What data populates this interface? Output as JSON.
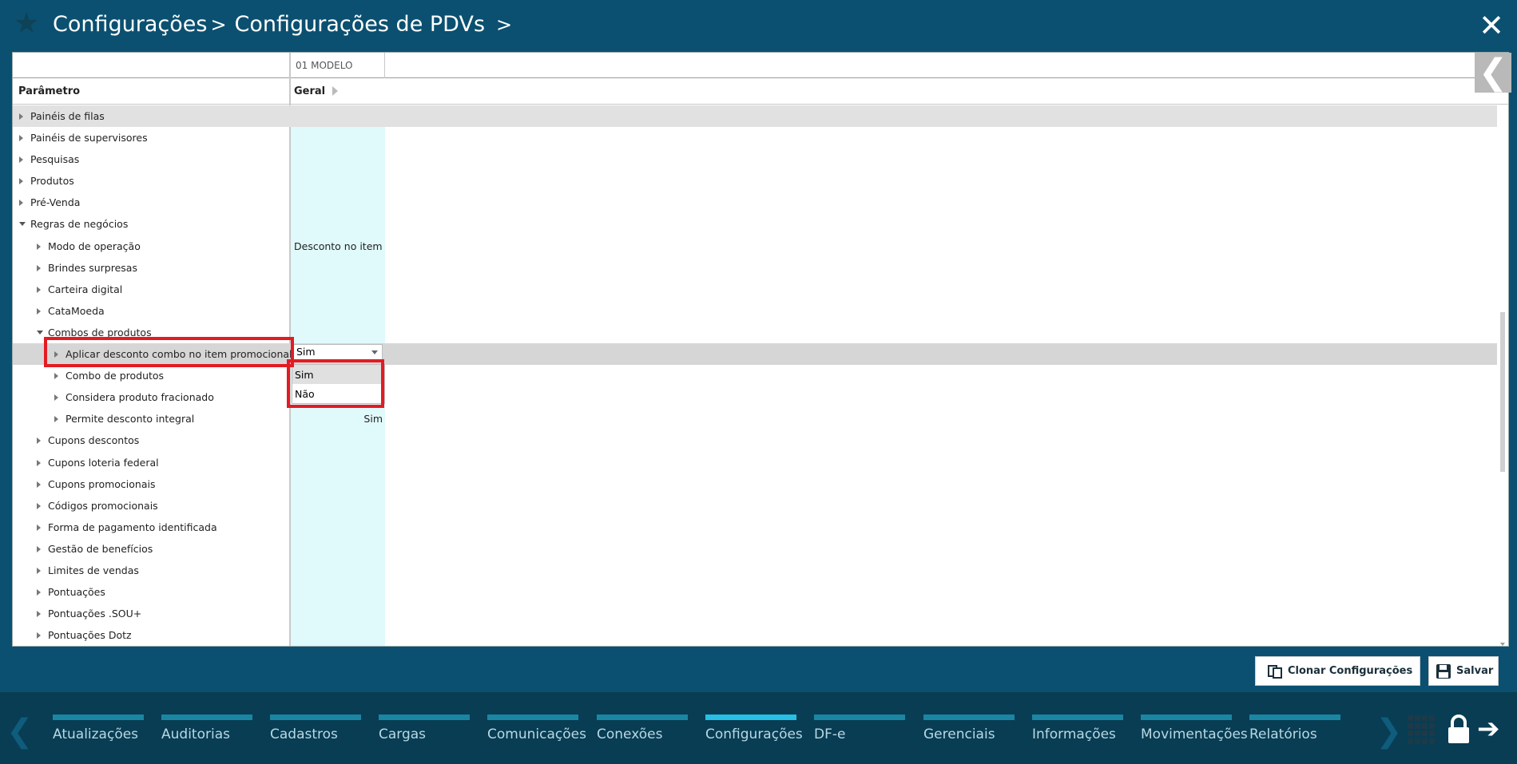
{
  "header": {
    "breadcrumb_1": "Configurações",
    "breadcrumb_sep_1": ">",
    "breadcrumb_2": "Configurações de PDVs",
    "breadcrumb_sep_2": ">",
    "close_icon": "✕"
  },
  "grid": {
    "model_header": "01 MODELO",
    "param_header": "Parâmetro",
    "group_header": "Geral",
    "rows": [
      {
        "label": "Painéis de filas",
        "value": ""
      },
      {
        "label": "Painéis de supervisores",
        "value": ""
      },
      {
        "label": "Pesquisas",
        "value": ""
      },
      {
        "label": "Produtos",
        "value": ""
      },
      {
        "label": "Pré-Venda",
        "value": ""
      },
      {
        "label": "Regras de negócios",
        "value": ""
      },
      {
        "label": "Modo de operação",
        "value": "Desconto no item"
      },
      {
        "label": "Brindes surpresas",
        "value": ""
      },
      {
        "label": "Carteira digital",
        "value": ""
      },
      {
        "label": "CataMoeda",
        "value": ""
      },
      {
        "label": "Combos de produtos",
        "value": ""
      },
      {
        "label": "Aplicar desconto combo no item promocional",
        "value": ""
      },
      {
        "label": "Combo de produtos",
        "value": ""
      },
      {
        "label": "Considera produto fracionado",
        "value": ""
      },
      {
        "label": "Permite desconto integral",
        "value": "Sim"
      },
      {
        "label": "Cupons descontos",
        "value": ""
      },
      {
        "label": "Cupons loteria federal",
        "value": ""
      },
      {
        "label": "Cupons promocionais",
        "value": ""
      },
      {
        "label": "Códigos promocionais",
        "value": ""
      },
      {
        "label": "Forma de pagamento identificada",
        "value": ""
      },
      {
        "label": "Gestão de benefícios",
        "value": ""
      },
      {
        "label": "Limites de vendas",
        "value": ""
      },
      {
        "label": "Pontuações",
        "value": ""
      },
      {
        "label": "Pontuações .SOU+",
        "value": ""
      },
      {
        "label": "Pontuações Dotz",
        "value": ""
      }
    ],
    "select_value": "Sim",
    "dropdown_options": [
      "Sim",
      "Não"
    ],
    "side_tab_icon": "❮"
  },
  "actions": {
    "clone_label": "Clonar Configurações",
    "save_label": "Salvar"
  },
  "nav": {
    "tabs": [
      "Atualizações",
      "Auditorias",
      "Cadastros",
      "Cargas",
      "Comunicações",
      "Conexões",
      "Configurações",
      "DF-e",
      "Gerenciais",
      "Informações",
      "Movimentações",
      "Relatórios"
    ],
    "active": "Configurações",
    "prev_icon": "❮",
    "next_icon": "❯",
    "exit_icon": "➔"
  },
  "colors": {
    "header_bg": "#0b5070",
    "bottom_bg": "#083d54",
    "highlight_red": "#e31b23",
    "value_column": "#e0f9fb",
    "active_tab": "#27bfe3"
  }
}
